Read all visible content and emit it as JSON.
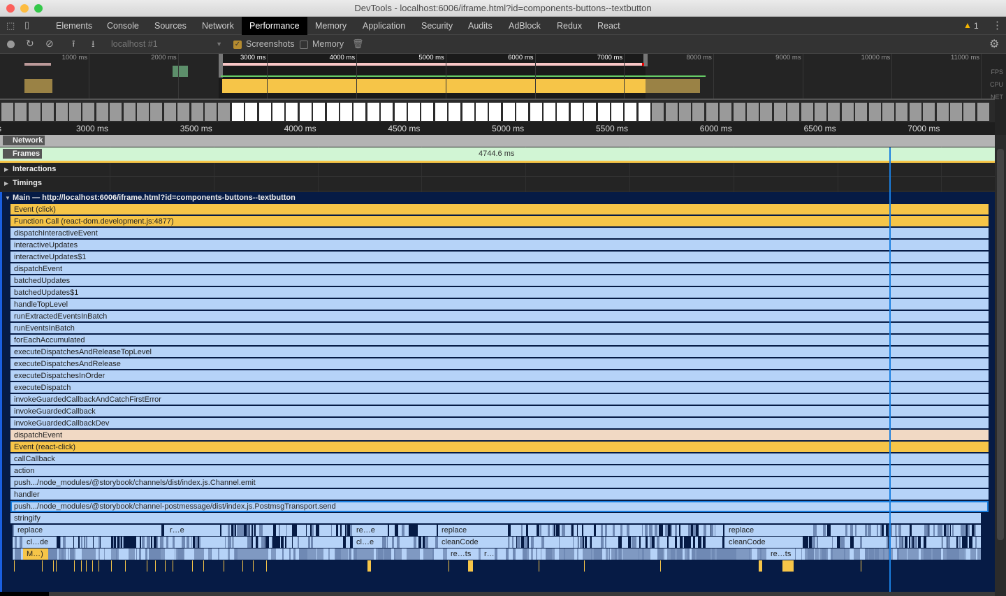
{
  "window": {
    "title": "DevTools - localhost:6006/iframe.html?id=components-buttons--textbutton"
  },
  "tabs": [
    "Elements",
    "Console",
    "Sources",
    "Network",
    "Performance",
    "Memory",
    "Application",
    "Security",
    "Audits",
    "AdBlock",
    "Redux",
    "React"
  ],
  "active_tab": "Performance",
  "warnings": {
    "icon": "warning-icon",
    "count": "1"
  },
  "toolbar": {
    "target": "localhost #1",
    "screenshots_label": "Screenshots",
    "screenshots_checked": true,
    "memory_label": "Memory",
    "memory_checked": false
  },
  "overview": {
    "ticks": [
      "1000 ms",
      "2000 ms",
      "3000 ms",
      "4000 ms",
      "5000 ms",
      "6000 ms",
      "7000 ms",
      "8000 ms",
      "9000 ms",
      "10000 ms",
      "11000 ms"
    ],
    "lanes": [
      "FPS",
      "CPU",
      "NET"
    ]
  },
  "ruler": {
    "ticks": [
      "3000 ms",
      "3500 ms",
      "4000 ms",
      "4500 ms",
      "5000 ms",
      "5500 ms",
      "6000 ms",
      "6500 ms",
      "7000 ms"
    ]
  },
  "tracks": {
    "network": "Network",
    "frames": "Frames",
    "frames_duration": "4744.6 ms",
    "interactions": "Interactions",
    "timings": "Timings",
    "main": "Main — http://localhost:6006/iframe.html?id=components-buttons--textbutton"
  },
  "colors": {
    "scripting": "#f6c548",
    "js_frame": "#b6d3f8",
    "event": "#f1d9c4",
    "main_bg": "#061b45",
    "frames": "#d1f5d4",
    "cursor": "#1a7fe0"
  },
  "flame": [
    {
      "label": "Event (click)",
      "type": "scripting"
    },
    {
      "label": "Function Call (react-dom.development.js:4877)",
      "type": "scripting"
    },
    {
      "label": "dispatchInteractiveEvent",
      "type": "js"
    },
    {
      "label": "interactiveUpdates",
      "type": "js"
    },
    {
      "label": "interactiveUpdates$1",
      "type": "js"
    },
    {
      "label": "dispatchEvent",
      "type": "js"
    },
    {
      "label": "batchedUpdates",
      "type": "js"
    },
    {
      "label": "batchedUpdates$1",
      "type": "js"
    },
    {
      "label": "handleTopLevel",
      "type": "js"
    },
    {
      "label": "runExtractedEventsInBatch",
      "type": "js"
    },
    {
      "label": "runEventsInBatch",
      "type": "js"
    },
    {
      "label": "forEachAccumulated",
      "type": "js"
    },
    {
      "label": "executeDispatchesAndReleaseTopLevel",
      "type": "js"
    },
    {
      "label": "executeDispatchesAndRelease",
      "type": "js"
    },
    {
      "label": "executeDispatchesInOrder",
      "type": "js"
    },
    {
      "label": "executeDispatch",
      "type": "js"
    },
    {
      "label": "invokeGuardedCallbackAndCatchFirstError",
      "type": "js"
    },
    {
      "label": "invokeGuardedCallback",
      "type": "js"
    },
    {
      "label": "invokeGuardedCallbackDev",
      "type": "js"
    },
    {
      "label": "dispatchEvent",
      "type": "event"
    },
    {
      "label": "Event (react-click)",
      "type": "scripting"
    },
    {
      "label": "callCallback",
      "type": "js"
    },
    {
      "label": "action",
      "type": "js"
    },
    {
      "label": "push.../node_modules/@storybook/channels/dist/index.js.Channel.emit",
      "type": "js"
    },
    {
      "label": "handler",
      "type": "js"
    },
    {
      "label": "push.../node_modules/@storybook/channel-postmessage/dist/index.js.PostmsgTransport.send",
      "type": "js",
      "selected": true
    },
    {
      "label": "stringify",
      "type": "js"
    }
  ],
  "deep_rows": [
    [
      "replace",
      "r…e",
      "re…e",
      "replace",
      "replace"
    ],
    [
      "cl…de",
      "cl…e",
      "cleanCode",
      "cleanCode"
    ],
    [
      "M…)",
      "re…ts",
      "r…",
      "re…ts"
    ]
  ]
}
